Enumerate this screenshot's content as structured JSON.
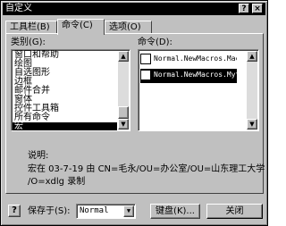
{
  "window": {
    "title": "自定义",
    "help_button": "?",
    "close_button": "×"
  },
  "tabs": [
    {
      "label": "工具栏(B)",
      "active": false
    },
    {
      "label": "命令(C)",
      "active": true
    },
    {
      "label": "选项(O)",
      "active": false
    }
  ],
  "categories": {
    "label": "类别(G):",
    "items": [
      "窗口和帮助",
      "绘图",
      "自选图形",
      "边框",
      "邮件合并",
      "窗体",
      "控件工具箱",
      "所有命令",
      "宏"
    ],
    "selected_index": 8
  },
  "commands": {
    "label": "命令(D):",
    "items": [
      {
        "label": "Normal.NewMacros.Mac",
        "icon": "macro-icon"
      },
      {
        "label": "Normal.NewMacros.Myt",
        "icon": "macro-icon"
      }
    ],
    "selected_index": 1
  },
  "description": {
    "label": "说明:",
    "line1": "宏在 03-7-19 由 CN=毛永/OU=办公室/OU=山东理工大学",
    "line2": "/O=xdlg 录制"
  },
  "footer": {
    "help_icon": "help-icon",
    "save_in_label": "保存于(S):",
    "save_in_value": "Normal",
    "keyboard_button": "键盘(K)...",
    "close_button": "关闭"
  }
}
